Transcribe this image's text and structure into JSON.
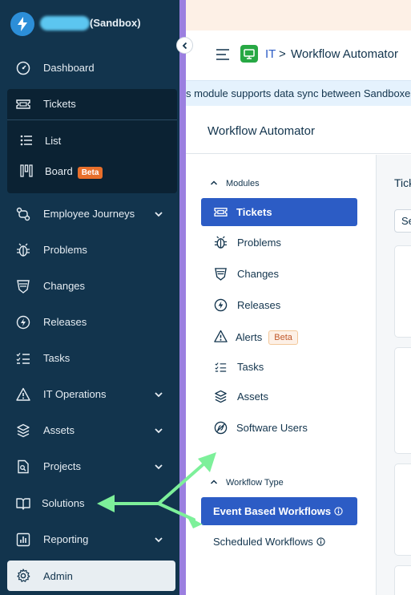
{
  "sidebar": {
    "org_suffix": "(Sandbox)",
    "items": [
      {
        "label": "Dashboard",
        "icon": "dashboard-icon"
      },
      {
        "label": "Tickets",
        "icon": "ticket-icon"
      },
      {
        "label": "Employee Journeys",
        "icon": "journey-icon"
      },
      {
        "label": "Problems",
        "icon": "bug-icon"
      },
      {
        "label": "Changes",
        "icon": "shield-icon"
      },
      {
        "label": "Releases",
        "icon": "release-icon"
      },
      {
        "label": "Tasks",
        "icon": "tasks-icon"
      },
      {
        "label": "IT Operations",
        "icon": "alert-icon"
      },
      {
        "label": "Assets",
        "icon": "layers-icon"
      },
      {
        "label": "Projects",
        "icon": "projects-icon"
      },
      {
        "label": "Solutions",
        "icon": "book-icon"
      },
      {
        "label": "Reporting",
        "icon": "report-icon"
      },
      {
        "label": "Admin",
        "icon": "gear-icon"
      }
    ],
    "tickets_sub": {
      "list_label": "List",
      "board_label": "Board",
      "board_badge": "Beta"
    },
    "accent": "#12344d"
  },
  "header": {
    "breadcrumb_module": "IT",
    "breadcrumb_sep": ">",
    "breadcrumb_title": "Workflow Automator"
  },
  "info_banner": {
    "text": "s module supports data sync between Sandboxes"
  },
  "page": {
    "title": "Workflow Automator"
  },
  "modules_panel": {
    "modules_heading": "Modules",
    "modules": [
      {
        "label": "Tickets",
        "icon": "ticket-icon",
        "active": true
      },
      {
        "label": "Problems",
        "icon": "bug-icon"
      },
      {
        "label": "Changes",
        "icon": "shield-icon"
      },
      {
        "label": "Releases",
        "icon": "release-icon"
      },
      {
        "label": "Alerts",
        "icon": "alert-icon",
        "badge": "Beta"
      },
      {
        "label": "Tasks",
        "icon": "tasks-icon"
      },
      {
        "label": "Assets",
        "icon": "layers-icon"
      },
      {
        "label": "Software Users",
        "icon": "software-icon"
      }
    ],
    "workflow_heading": "Workflow Type",
    "workflow_types": [
      {
        "label": "Event Based Workflows",
        "active": true
      },
      {
        "label": "Scheduled Workflows"
      }
    ]
  },
  "right_panel": {
    "title_partial": "Tick",
    "select_partial": "Se"
  },
  "colors": {
    "active_blue": "#2c5cc5",
    "arrow_green": "#7df09a",
    "beta_orange": "#e86f2b"
  }
}
